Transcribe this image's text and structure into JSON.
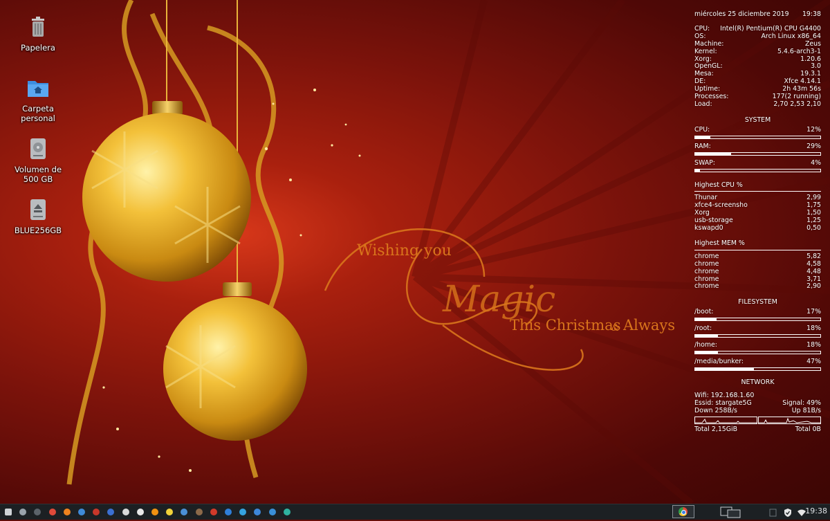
{
  "wallpaper": {
    "greeting_line1": "Wishing you",
    "greeting_script": "Magic",
    "greeting_line2": "This Christmas",
    "greeting_amp": "&",
    "greeting_line3": "Always"
  },
  "desktop_icons": [
    {
      "label": "Papelera",
      "icon": "trash-icon"
    },
    {
      "label": "Carpeta\npersonal",
      "icon": "home-folder-icon"
    },
    {
      "label": "Volumen de\n500 GB",
      "icon": "drive-icon"
    },
    {
      "label": "BLUE256GB",
      "icon": "usb-drive-icon"
    }
  ],
  "conky": {
    "date": "miércoles 25 diciembre 2019",
    "time": "19:38",
    "sysinfo": [
      {
        "k": "CPU:",
        "v": "Intel(R) Pentium(R) CPU G4400"
      },
      {
        "k": "OS:",
        "v": "Arch Linux x86_64"
      },
      {
        "k": "Machine:",
        "v": "Zeus"
      },
      {
        "k": "Kernel:",
        "v": "5.4.6-arch3-1"
      },
      {
        "k": "Xorg:",
        "v": "1.20.6"
      },
      {
        "k": "OpenGL:",
        "v": "3.0"
      },
      {
        "k": "Mesa:",
        "v": "19.3.1"
      },
      {
        "k": "DE:",
        "v": "Xfce 4.14.1"
      },
      {
        "k": "Uptime:",
        "v": "2h 43m 56s"
      },
      {
        "k": "Processes:",
        "v": "177(2 running)"
      },
      {
        "k": "Load:",
        "v": "2,70 2,53 2,10"
      }
    ],
    "system_header": "SYSTEM",
    "usage": [
      {
        "k": "CPU:",
        "v": "12%",
        "level": 0.12
      },
      {
        "k": "RAM:",
        "v": "29%",
        "level": 0.29
      },
      {
        "k": "SWAP:",
        "v": "4%",
        "level": 0.04
      }
    ],
    "top_cpu_header": "Highest CPU %",
    "top_cpu": [
      {
        "k": "Thunar",
        "v": "2,99"
      },
      {
        "k": "xfce4-screensho",
        "v": "1,75"
      },
      {
        "k": "Xorg",
        "v": "1,50"
      },
      {
        "k": "usb-storage",
        "v": "1,25"
      },
      {
        "k": "kswapd0",
        "v": "0,50"
      }
    ],
    "top_mem_header": "Highest MEM %",
    "top_mem": [
      {
        "k": "chrome",
        "v": "5,82"
      },
      {
        "k": "chrome",
        "v": "4,58"
      },
      {
        "k": "chrome",
        "v": "4,48"
      },
      {
        "k": "chrome",
        "v": "3,71"
      },
      {
        "k": "chrome",
        "v": "2,90"
      }
    ],
    "fs_header": "FILESYSTEM",
    "filesystems": [
      {
        "k": "/boot:",
        "v": "17%",
        "level": 0.17
      },
      {
        "k": "/root:",
        "v": "18%",
        "level": 0.18
      },
      {
        "k": "/home:",
        "v": "18%",
        "level": 0.18
      },
      {
        "k": "/media/bunker:",
        "v": "47%",
        "level": 0.47
      }
    ],
    "net_header": "NETWORK",
    "wifi": "Wifi: 192.168.1.60",
    "essid": "Essid: stargate5G",
    "signal": "Signal: 49%",
    "down": "Down 258B/s",
    "up": "Up 81B/s",
    "total_down": "Total 2,15GiB",
    "total_up": "Total 0B"
  },
  "taskbar": {
    "launchers": [
      {
        "name": "whisker-menu-icon",
        "color": "#cfd3d6"
      },
      {
        "name": "file-manager-icon",
        "color": "#9aa3ab"
      },
      {
        "name": "terminal-icon",
        "color": "#5c636a"
      },
      {
        "name": "chrome-icon",
        "color": "#e04a3a"
      },
      {
        "name": "firefox-icon",
        "color": "#f0821e"
      },
      {
        "name": "mail-icon",
        "color": "#3f8ad8"
      },
      {
        "name": "filezilla-icon",
        "color": "#c8372a"
      },
      {
        "name": "bitwarden-icon",
        "color": "#3b6fd1"
      },
      {
        "name": "rabbit-icon",
        "color": "#d9d9d9"
      },
      {
        "name": "inkscape-icon",
        "color": "#e8e8e8"
      },
      {
        "name": "vlc-icon",
        "color": "#f29111"
      },
      {
        "name": "banana-icon",
        "color": "#f2d23a"
      },
      {
        "name": "image-viewer-icon",
        "color": "#4b8fd6"
      },
      {
        "name": "gimp-icon",
        "color": "#8c6a4a"
      },
      {
        "name": "downloader-icon",
        "color": "#d23a2a"
      },
      {
        "name": "sync-icon",
        "color": "#2f7fd9"
      },
      {
        "name": "telegram-icon",
        "color": "#35a3e0"
      },
      {
        "name": "cloud-icon",
        "color": "#3d87d9"
      },
      {
        "name": "monitor-icon",
        "color": "#3a8fd8"
      },
      {
        "name": "settings-icon",
        "color": "#2fb3a0"
      }
    ],
    "active_window_icon": "chrome-icon",
    "tray": [
      "shield-icon",
      "wifi-icon"
    ],
    "clock": "19:38"
  }
}
